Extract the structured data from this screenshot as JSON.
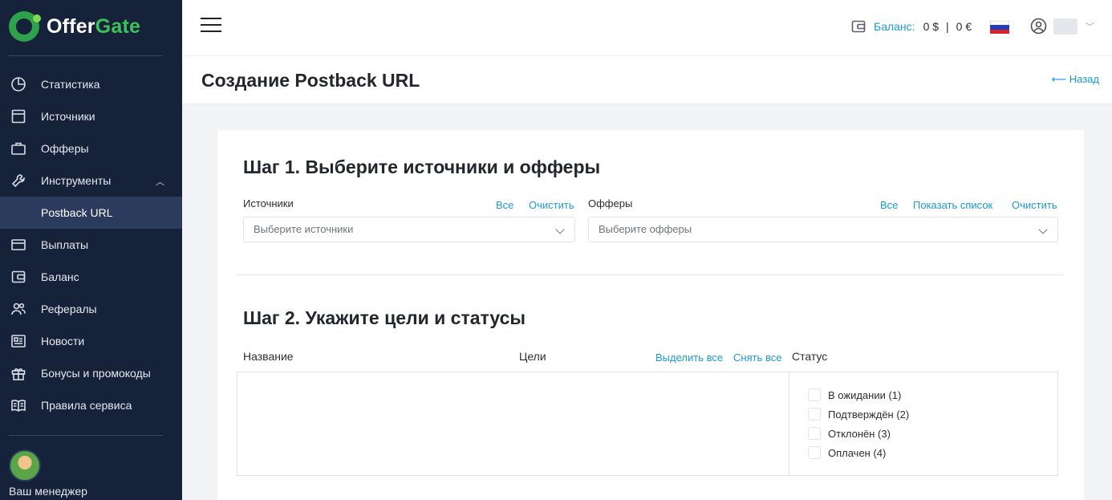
{
  "brand": {
    "part1": "Offer",
    "part2": "Gate",
    "accent": "#3bc25a"
  },
  "sidebar": {
    "items": [
      {
        "label": "Статистика",
        "icon": "chart-pie-icon"
      },
      {
        "label": "Источники",
        "icon": "window-icon"
      },
      {
        "label": "Офферы",
        "icon": "briefcase-icon"
      },
      {
        "label": "Инструменты",
        "icon": "wrench-icon"
      },
      {
        "label": "Postback URL",
        "icon": ""
      },
      {
        "label": "Выплаты",
        "icon": "credit-card-icon"
      },
      {
        "label": "Баланс",
        "icon": "wallet-icon"
      },
      {
        "label": "Рефералы",
        "icon": "users-icon"
      },
      {
        "label": "Новости",
        "icon": "newspaper-icon"
      },
      {
        "label": "Бонусы и промокоды",
        "icon": "gift-icon"
      },
      {
        "label": "Правила сервиса",
        "icon": "book-icon"
      }
    ],
    "manager_label": "Ваш менеджер"
  },
  "topbar": {
    "balance_label": "Баланс:",
    "balance_usd": "0 $",
    "balance_eur": "0 €"
  },
  "page": {
    "title": "Создание Postback URL",
    "back_label": "⟵ Назад"
  },
  "step1": {
    "title": "Шаг 1. Выберите источники и офферы",
    "sources": {
      "label": "Источники",
      "all": "Все",
      "clear": "Очистить",
      "placeholder": "Выберите источники"
    },
    "offers": {
      "label": "Офферы",
      "all": "Все",
      "show_list": "Показать список",
      "clear": "Очистить",
      "placeholder": "Выберите офферы"
    }
  },
  "step2": {
    "title": "Шаг 2. Укажите цели и статусы",
    "col_name": "Название",
    "col_goals": "Цели",
    "select_all": "Выделить все",
    "deselect_all": "Снять все",
    "col_status": "Статус",
    "statuses": [
      "В ожидании (1)",
      "Подтверждён (2)",
      "Отклонён (3)",
      "Оплачен (4)"
    ]
  }
}
